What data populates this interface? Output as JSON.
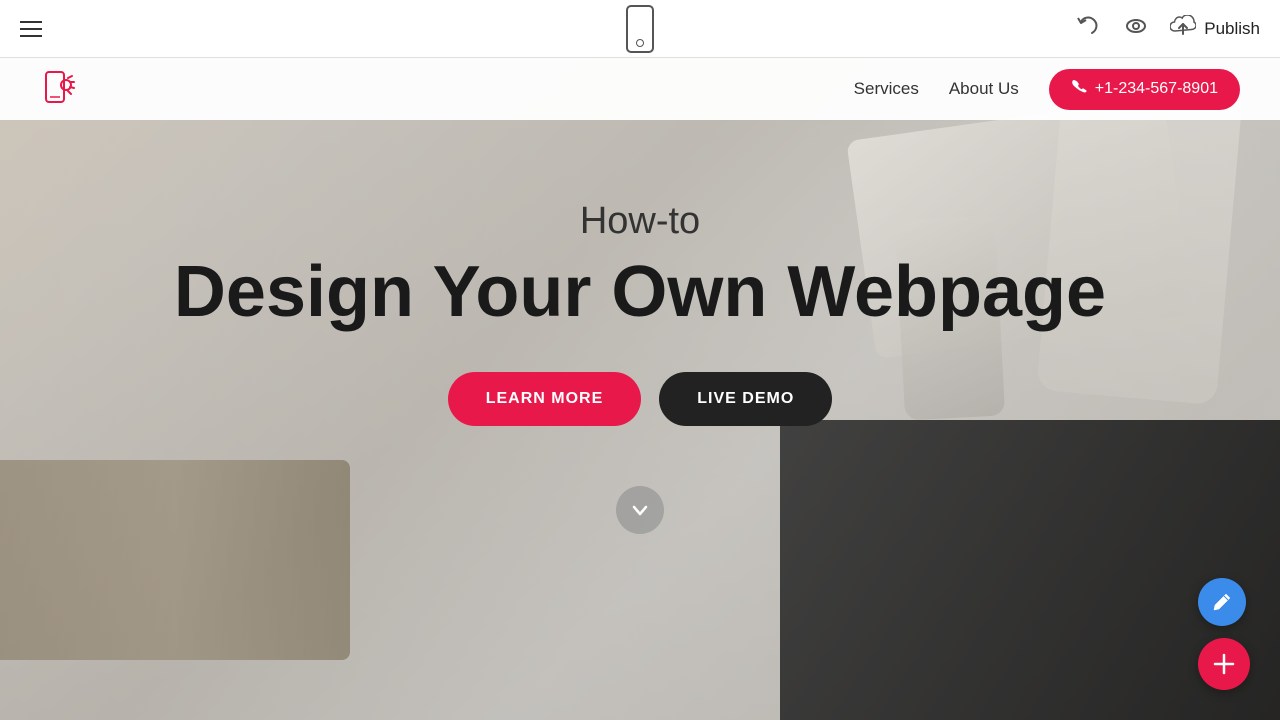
{
  "toolbar": {
    "publish_label": "Publish",
    "hamburger_label": "Menu",
    "mobile_view_label": "Mobile View",
    "undo_symbol": "↩",
    "eye_symbol": "👁",
    "cloud_symbol": "⬆"
  },
  "site": {
    "nav": {
      "services_label": "Services",
      "about_us_label": "About Us",
      "phone_number": "+1-234-567-8901"
    },
    "hero": {
      "subtitle": "How-to",
      "title": "Design Your Own Webpage",
      "learn_more_label": "LEARN MORE",
      "live_demo_label": "LIVE DEMO"
    }
  },
  "colors": {
    "accent": "#e8194a",
    "dark": "#222222",
    "blue": "#3b8beb"
  },
  "icons": {
    "hamburger": "hamburger-icon",
    "mobile": "mobile-frame-icon",
    "undo": "undo-icon",
    "eye": "eye-icon",
    "publish_cloud": "publish-cloud-icon",
    "phone": "phone-icon",
    "scroll_down": "scroll-down-icon",
    "edit_pen": "edit-pen-icon",
    "add_plus": "add-plus-icon"
  }
}
